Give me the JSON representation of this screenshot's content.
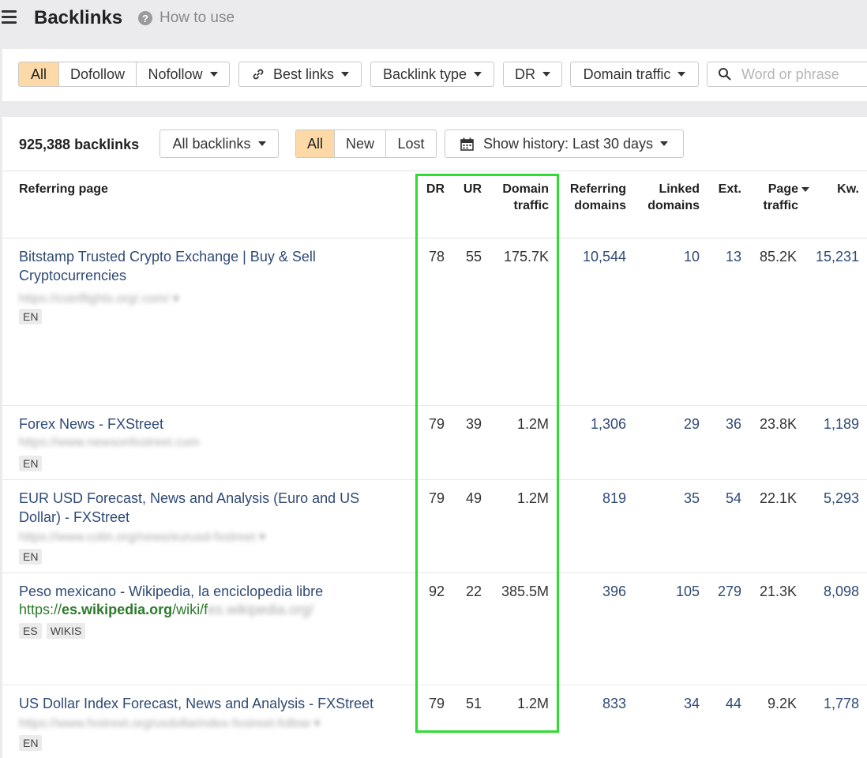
{
  "header": {
    "title": "Backlinks",
    "help_label": "How to use",
    "help_icon": "?"
  },
  "filters": {
    "link_type_options": [
      "All",
      "Dofollow",
      "Nofollow"
    ],
    "best_links": "Best links",
    "backlink_type": "Backlink type",
    "dr": "DR",
    "domain_traffic": "Domain traffic",
    "search_placeholder": "Word or phrase"
  },
  "toolbar": {
    "count": "925,388 backlinks",
    "all_backlinks": "All backlinks",
    "status_options": [
      "All",
      "New",
      "Lost"
    ],
    "history": "Show history: Last 30 days"
  },
  "columns": {
    "referring_page": "Referring page",
    "dr": "DR",
    "ur": "UR",
    "domain_traffic_1": "Domain",
    "domain_traffic_2": "traffic",
    "referring_domains_1": "Referring",
    "referring_domains_2": "domains",
    "linked_domains_1": "Linked",
    "linked_domains_2": "domains",
    "ext": "Ext.",
    "page_traffic_1": "Page",
    "page_traffic_2": "traffic",
    "kw": "Kw."
  },
  "rows": [
    {
      "title": "Bitstamp Trusted Crypto Exchange | Buy & Sell Cryptocurrencies",
      "url": "https://coinflights.org/.com/ ▾",
      "tags": [
        "EN"
      ],
      "dr": "78",
      "ur": "55",
      "domain_traffic": "175.7K",
      "referring_domains": "10,544",
      "linked_domains": "10",
      "ext": "13",
      "page_traffic": "85.2K",
      "kw": "15,231"
    },
    {
      "title": "Forex News - FXStreet",
      "url": "https://www.newsonfxstreet.com",
      "tags": [
        "EN"
      ],
      "dr": "79",
      "ur": "39",
      "domain_traffic": "1.2M",
      "referring_domains": "1,306",
      "linked_domains": "29",
      "ext": "36",
      "page_traffic": "23.8K",
      "kw": "1,189"
    },
    {
      "title": "EUR USD Forecast, News and Analysis (Euro and US Dollar) - FXStreet",
      "url": "https://www.colin.org/news/eurusd-fxstreet ▾",
      "tags": [
        "EN"
      ],
      "dr": "79",
      "ur": "49",
      "domain_traffic": "1.2M",
      "referring_domains": "819",
      "linked_domains": "35",
      "ext": "54",
      "page_traffic": "22.1K",
      "kw": "5,293"
    },
    {
      "title": "Peso mexicano - Wikipedia, la enciclopedia libre",
      "url_prefix": "https://",
      "url_domain": "es.wikipedia.org",
      "url_path": "/wiki/f",
      "url_blur": "es.wikipedia.org/",
      "tags": [
        "ES",
        "WIKIS"
      ],
      "dr": "92",
      "ur": "22",
      "domain_traffic": "385.5M",
      "referring_domains": "396",
      "linked_domains": "105",
      "ext": "279",
      "page_traffic": "21.3K",
      "kw": "8,098"
    },
    {
      "title": "US Dollar Index Forecast, News and Analysis - FXStreet",
      "url": "https://www.fxstreet.org/usdollarindex-fxstreet-follow ▾",
      "tags": [
        "EN"
      ],
      "dr": "79",
      "ur": "51",
      "domain_traffic": "1.2M",
      "referring_domains": "833",
      "linked_domains": "34",
      "ext": "44",
      "page_traffic": "9.2K",
      "kw": "1,778"
    }
  ]
}
